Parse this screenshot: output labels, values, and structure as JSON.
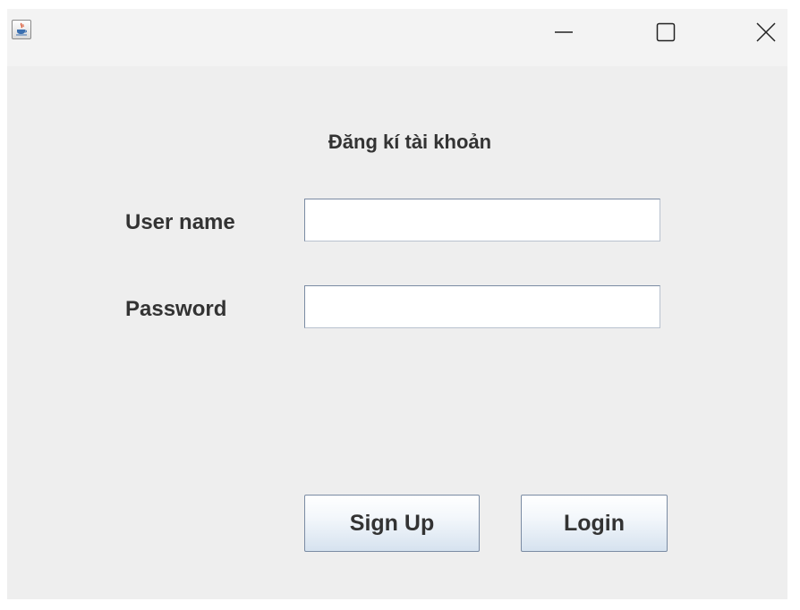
{
  "window": {
    "controls": {
      "app_icon": "java-coffee-icon",
      "minimize_icon": "minimize-icon",
      "maximize_icon": "maximize-icon",
      "close_icon": "close-icon"
    }
  },
  "form": {
    "heading": "Đăng kí tài khoản",
    "username": {
      "label": "User name",
      "value": "",
      "placeholder": ""
    },
    "password": {
      "label": "Password",
      "value": "",
      "placeholder": ""
    },
    "buttons": {
      "signup_label": "Sign Up",
      "login_label": "Login"
    }
  },
  "colors": {
    "window_background": "#eeeeee",
    "titlebar_background": "#f3f3f3",
    "text": "#333333",
    "button_border": "#7a8ba3"
  }
}
